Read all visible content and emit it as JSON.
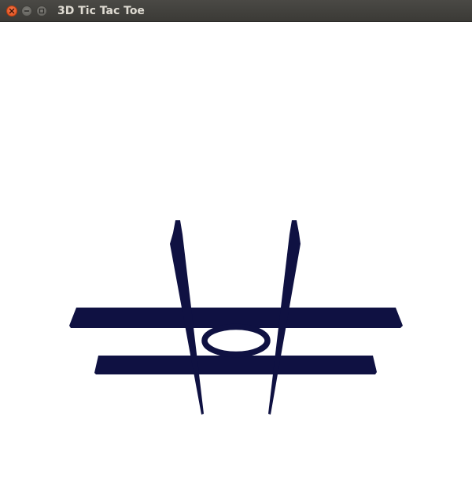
{
  "window": {
    "title": "3D Tic Tac Toe",
    "controls": [
      "close",
      "minimize",
      "maximize"
    ]
  },
  "game": {
    "board_color": "#0f1142",
    "background_color": "#ffffff",
    "cells": [
      [
        "",
        "",
        ""
      ],
      [
        "",
        "O",
        ""
      ],
      [
        "",
        "",
        ""
      ]
    ]
  }
}
